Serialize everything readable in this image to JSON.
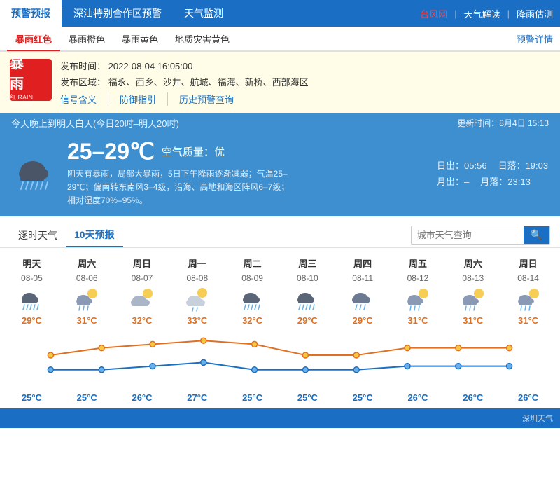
{
  "nav": {
    "items": [
      {
        "label": "预警预报",
        "active": true
      },
      {
        "label": "深汕特别合作区预警",
        "active": false
      },
      {
        "label": "天气监测",
        "active": false
      }
    ],
    "right": [
      {
        "label": "台风网",
        "color": "red"
      },
      {
        "label": "天气解读",
        "color": "white"
      },
      {
        "label": "降雨估测",
        "color": "white"
      }
    ]
  },
  "alert_tabs": {
    "items": [
      "暴雨红色",
      "暴雨橙色",
      "暴雨黄色",
      "地质灾害黄色"
    ],
    "active": 0,
    "detail_label": "预警详情"
  },
  "alert": {
    "icon_line1": "暴",
    "icon_line2": "雨",
    "icon_line3": "红 RAIN STORM",
    "publish_time_label": "发布时间：",
    "publish_time": "2022-08-04 16:05:00",
    "area_label": "发布区域：",
    "area": "福永、西乡、沙井、航城、福海、新桥、西部海区",
    "links": [
      "信号含义",
      "防御指引",
      "历史预警查询"
    ]
  },
  "today": {
    "title": "今天晚上到明天白天(今日20时–明天20时)",
    "update": "更新时间：8月4日 15:13",
    "temp_range": "25–29℃",
    "quality_label": "空气质量：",
    "quality": "优",
    "desc": "阴天有暴雨，局部大暴雨，5日下午降雨逐渐减弱；气温25–29℃；偏南转东南风3–4级，沿海、高地和海区阵风6–7级；相对湿度70%–95%。",
    "sunrise_label": "日出：",
    "sunrise": "05:56",
    "sunset_label": "日落：",
    "sunset": "19:03",
    "moonrise_label": "月出：",
    "moonrise": "–",
    "moonset_label": "月落：",
    "moonset": "23:13"
  },
  "forecast": {
    "tabs": [
      "逐时天气",
      "10天预报"
    ],
    "active_tab": 1,
    "search_placeholder": "城市天气查询",
    "days": [
      {
        "day": "明天",
        "date": "08-05",
        "weather": "heavy_rain",
        "high": "29°C",
        "low": "25°C"
      },
      {
        "day": "周六",
        "date": "08-06",
        "weather": "cloud_sun_rain",
        "high": "31°C",
        "low": "25°C"
      },
      {
        "day": "周日",
        "date": "08-07",
        "weather": "cloud_sun",
        "high": "32°C",
        "low": "26°C"
      },
      {
        "day": "周一",
        "date": "08-08",
        "weather": "cloud_sun_light",
        "high": "33°C",
        "low": "27°C"
      },
      {
        "day": "周二",
        "date": "08-09",
        "weather": "heavy_rain",
        "high": "32°C",
        "low": "25°C"
      },
      {
        "day": "周三",
        "date": "08-10",
        "weather": "heavy_rain",
        "high": "29°C",
        "low": "25°C"
      },
      {
        "day": "周四",
        "date": "08-11",
        "weather": "cloud_rain",
        "high": "29°C",
        "low": "25°C"
      },
      {
        "day": "周五",
        "date": "08-12",
        "weather": "cloud_sun_rain",
        "high": "31°C",
        "low": "26°C"
      },
      {
        "day": "周六",
        "date": "08-13",
        "weather": "cloud_sun_rain",
        "high": "31°C",
        "low": "26°C"
      },
      {
        "day": "周日",
        "date": "08-14",
        "weather": "cloud_sun_rain",
        "high": "31°C",
        "low": "26°C"
      }
    ],
    "high_temps": [
      29,
      31,
      32,
      33,
      32,
      29,
      29,
      31,
      31,
      31
    ],
    "low_temps": [
      25,
      25,
      26,
      27,
      25,
      25,
      25,
      26,
      26,
      26
    ]
  }
}
